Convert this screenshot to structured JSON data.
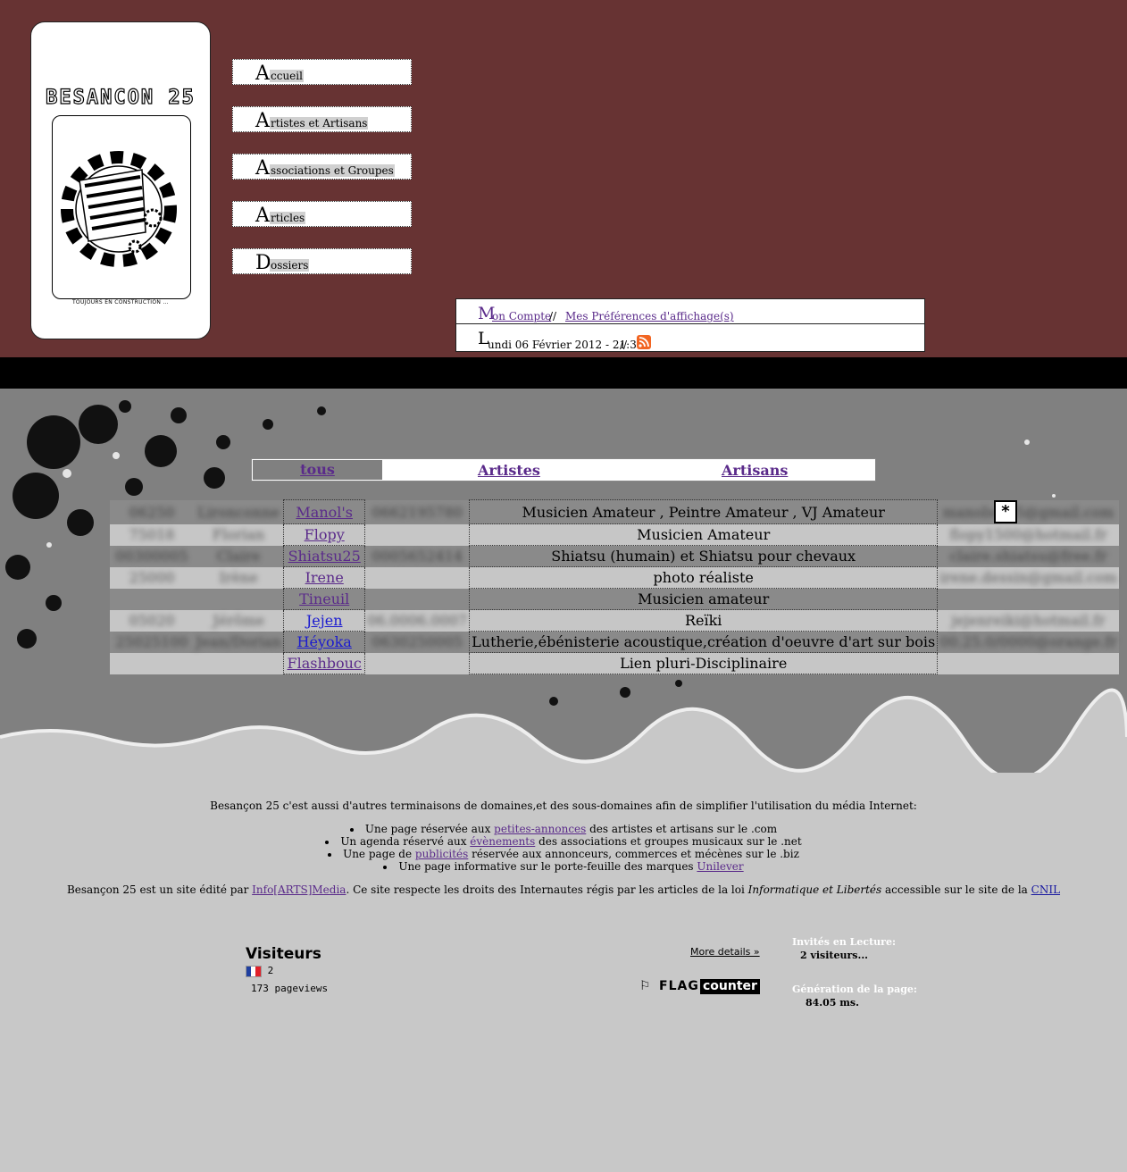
{
  "logo": {
    "title": "BESANCON 25",
    "tagline": "TOUJOURS EN CONSTRUCTION ..."
  },
  "nav": [
    {
      "initial": "A",
      "rest": "ccueil"
    },
    {
      "initial": "A",
      "rest": "rtistes et Artisans"
    },
    {
      "initial": "A",
      "rest": "ssociations et Groupes"
    },
    {
      "initial": "A",
      "rest": "rticles"
    },
    {
      "initial": "D",
      "rest": "ossiers"
    }
  ],
  "account": {
    "initial": "M",
    "mon_compte": "on Compte",
    "separator": "//",
    "preferences": "Mes Préférences d'affichage(s)",
    "date_initial": "L",
    "date_rest": "undi 06 Février 2012 - 21:36"
  },
  "filter": {
    "tous": "tous",
    "artistes": "Artistes",
    "artisans": "Artisans"
  },
  "people": [
    {
      "c1": "06250",
      "c2": "Lironconne",
      "name": "Manol's",
      "phone": "0662195780",
      "desc": "Musicien Amateur , Peintre Amateur , VJ Amateur",
      "email": "manolss.05@gmail.com"
    },
    {
      "c1": "75018",
      "c2": "Florian",
      "name": "Flopy",
      "phone": "",
      "desc": "Musicien Amateur",
      "email": "flopy1500@hotmail.fr"
    },
    {
      "c1": "00300005",
      "c2": "Claire",
      "name": "Shiatsu25",
      "phone": "0005652414",
      "desc": "Shiatsu (humain) et Shiatsu pour chevaux",
      "email": "claire.shiatsu@free.fr"
    },
    {
      "c1": "25000",
      "c2": "Irène",
      "name": "Irene",
      "phone": "",
      "desc": "photo réaliste",
      "email": "irene.dessin@gmail.com"
    },
    {
      "c1": "",
      "c2": "",
      "name": "Tineuil",
      "phone": "",
      "desc": "Musicien amateur",
      "email": ""
    },
    {
      "c1": "05020",
      "c2": "Jérôme",
      "name": "Jejen",
      "phone": "06.0006.0007",
      "desc": "Reïki",
      "email": "jejenreiki@hotmail.fr"
    },
    {
      "c1": "25025100",
      "c2": "Jean/Dorian",
      "name": "Héyoka",
      "phone": "0630250005",
      "desc": "Lutherie,ébénisterie acoustique,création d'oeuvre d'art sur bois",
      "email": "00.25.0/0000@orange.fr"
    },
    {
      "c1": "",
      "c2": "",
      "name": "Flashbouc",
      "phone": "",
      "desc": "Lien pluri-Disciplinaire",
      "email": ""
    }
  ],
  "star_label": "*",
  "footer": {
    "intro": "Besançon 25 c'est aussi d'autres terminaisons de domaines,et des sous-domaines afin de simplifier l'utilisation du média Internet:",
    "items": [
      {
        "before": "Une page réservée aux ",
        "link": "petites-annonces",
        "after": " des artistes et artisans sur le .com"
      },
      {
        "before": "Un agenda réservé aux ",
        "link": "évènements",
        "after": " des associations et groupes musicaux sur le .net"
      },
      {
        "before": "Une page de ",
        "link": "publicités",
        "after": " réservée aux annonceurs, commerces et mécènes sur le .biz"
      },
      {
        "before": "Une page informative sur le porte-feuille des marques ",
        "link": "Unilever",
        "after": ""
      }
    ],
    "legal_before": "Besançon 25 est un site édité par ",
    "legal_link": "Info[ARTS]Media",
    "legal_mid": ". Ce site respecte les droits des Internautes régis par les articles de la loi ",
    "legal_em": "Informatique et Libertés",
    "legal_after": " accessible sur le site de la ",
    "legal_cnil": "CNIL"
  },
  "visitors": {
    "title": "Visiteurs",
    "count": "2",
    "pageviews": "173 pageviews",
    "more": "More details »",
    "flag": "FLAG",
    "counter": "counter"
  },
  "stats": {
    "guests_label": "Invités en Lecture:",
    "guests_value": "2 visiteurs...",
    "gen_label": "Génération de la page:",
    "gen_value": "84.05 ms."
  }
}
